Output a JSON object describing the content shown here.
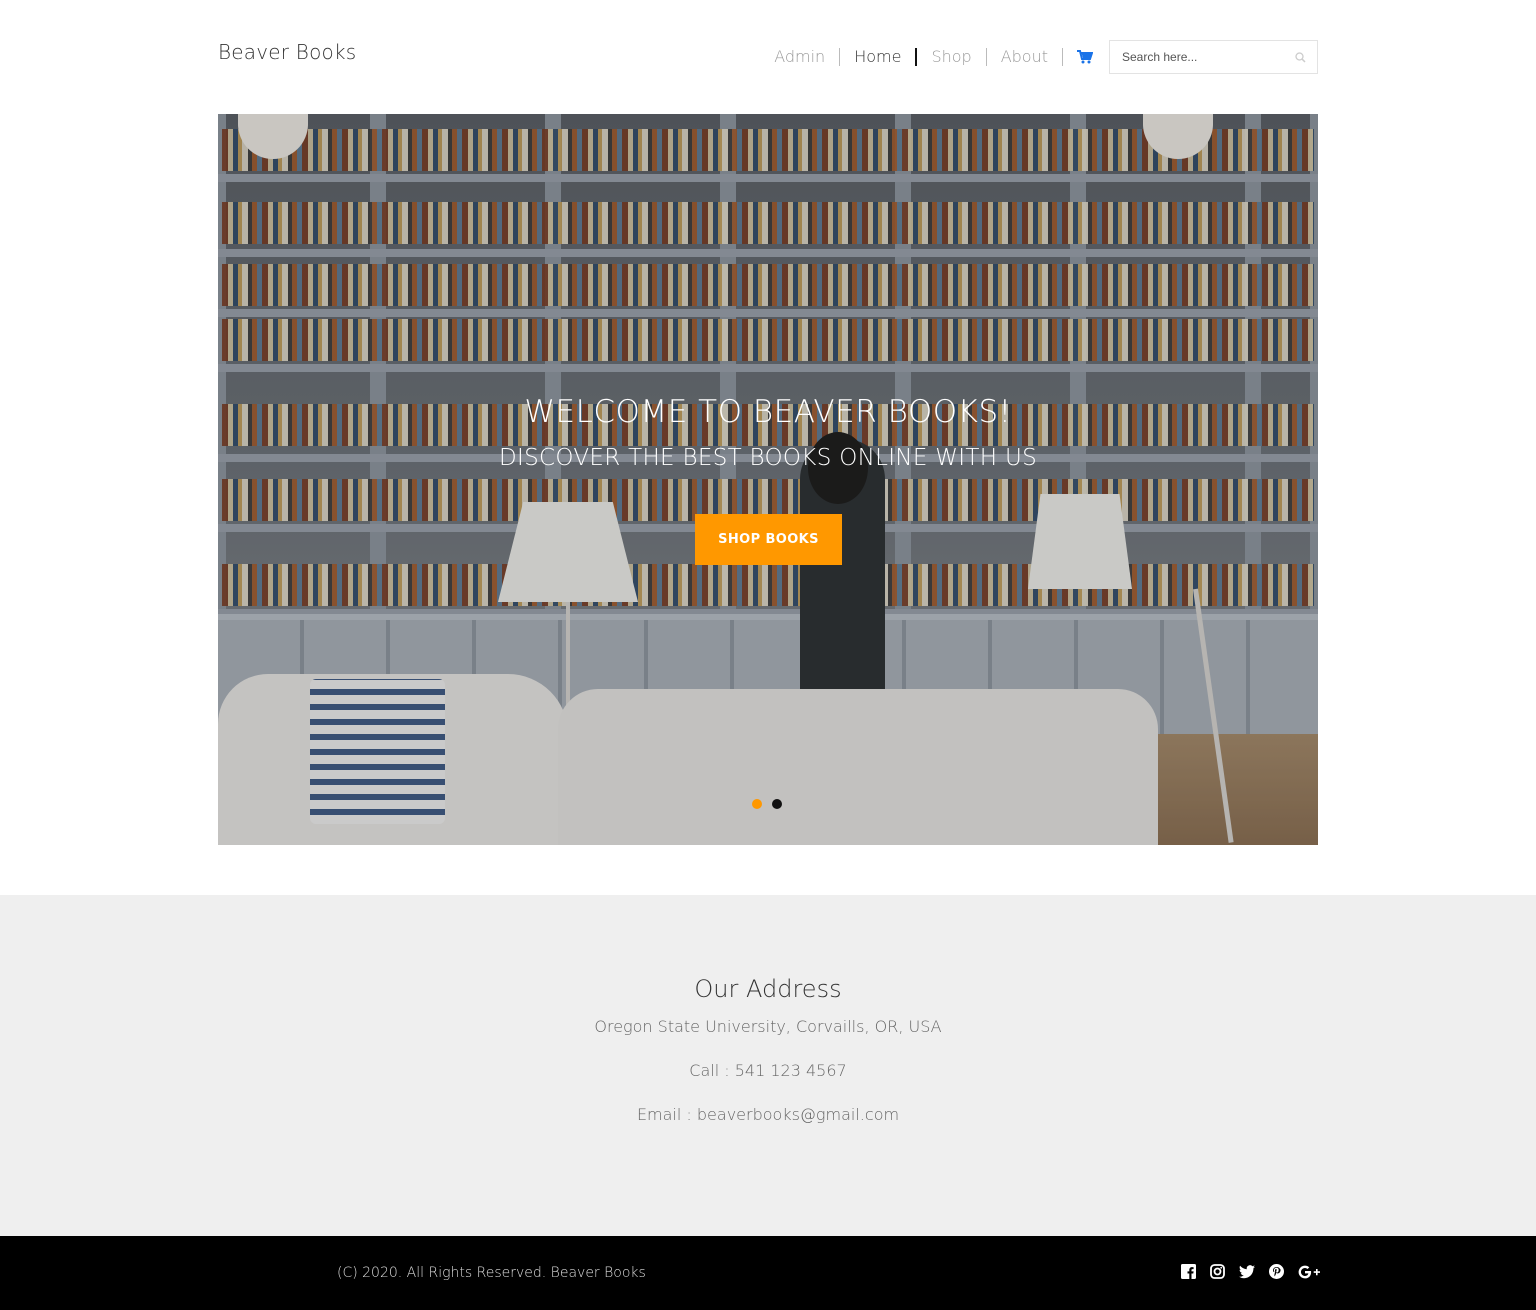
{
  "header": {
    "brand": "Beaver Books",
    "nav": [
      "Admin",
      "Home",
      "Shop",
      "About"
    ],
    "active_nav": "Home",
    "cart_icon": "shopping-cart-icon",
    "search": {
      "placeholder": "Search here...",
      "icon": "search-icon"
    }
  },
  "hero": {
    "title": "WELCOME TO BEAVER BOOKS!",
    "subtitle": "DISCOVER THE BEST BOOKS ONLINE WITH US",
    "cta_label": "SHOP BOOKS",
    "slides": 2,
    "active_slide": 1
  },
  "address": {
    "title": "Our Address",
    "location": "Oregon State University, Corvaills, OR, USA",
    "phone": "Call : 541 123 4567",
    "email": "Email : beaverbooks@gmail.com"
  },
  "footer": {
    "copyright": "(C) 2020. All Rights Reserved. Beaver Books",
    "social_icons": [
      "facebook-icon",
      "instagram-icon",
      "twitter-icon",
      "pinterest-icon",
      "google-plus-icon"
    ]
  },
  "colors": {
    "accent": "#ff9800",
    "cart_blue": "#1a73e8",
    "footer_bg": "#000000",
    "address_bg": "#efefef"
  }
}
